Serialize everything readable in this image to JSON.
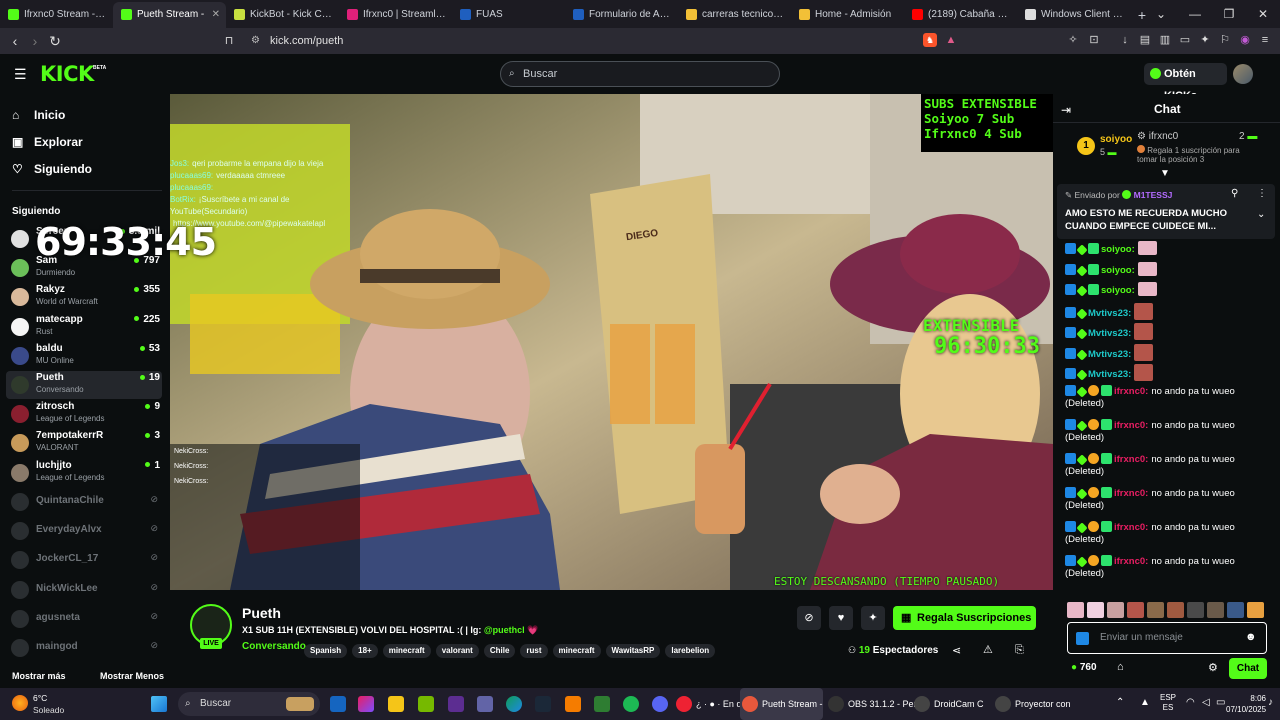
{
  "browser": {
    "tabs": [
      {
        "label": "Ifrxnc0 Stream - Kick D",
        "color": "#53fc18"
      },
      {
        "label": "Pueth Stream - ",
        "color": "#53fc18",
        "active": true
      },
      {
        "label": "KickBot - Kick Chatbot",
        "color": "#c8e040"
      },
      {
        "label": "Ifrxnc0 | Streamloots |",
        "color": "#e0207a"
      },
      {
        "label": "FUAS",
        "color": "#1f5fbf"
      },
      {
        "label": "Formulario de Acredita",
        "color": "#1f5fbf"
      },
      {
        "label": "carreras tecnico-en-ele",
        "color": "#f2c037"
      },
      {
        "label": "Home - Admisión",
        "color": "#f2c037"
      },
      {
        "label": "(2189) Cabaña acogedo",
        "color": "#ff0000"
      },
      {
        "label": "Windows Client | Droid",
        "color": "#ddd"
      }
    ],
    "new_tab": "+",
    "url": "kick.com/pueth"
  },
  "kick": {
    "logo": "KICK",
    "beta": "BETA",
    "search_placeholder": "Buscar",
    "get_kicks": "Obtén KICKs"
  },
  "sidebar": {
    "nav": [
      {
        "label": "Inicio",
        "icon": "⌂"
      },
      {
        "label": "Explorar",
        "icon": "▣"
      },
      {
        "label": "Siguiendo",
        "icon": "♡"
      }
    ],
    "following_title": "Siguiendo",
    "following": [
      {
        "name": "Spreen",
        "category": "",
        "count": "5.5 mil",
        "color": "#e0e0e0"
      },
      {
        "name": "Sam",
        "category": "Durmiendo",
        "count": "797",
        "color": "#6bbf59"
      },
      {
        "name": "Rakyz",
        "category": "World of Warcraft",
        "count": "355",
        "color": "#d9b99b"
      },
      {
        "name": "matecapp",
        "category": "Rust",
        "count": "225",
        "color": "#f5f5f5"
      },
      {
        "name": "baldu",
        "category": "MU Online",
        "count": "53",
        "color": "#3a4a8a"
      },
      {
        "name": "Pueth",
        "category": "Conversando",
        "count": "19",
        "color": "#2f3a2c"
      },
      {
        "name": "zitrosch",
        "category": "League of Legends",
        "count": "9",
        "color": "#8a1f2f"
      },
      {
        "name": "7empotakerrR",
        "category": "VALORANT",
        "count": "3",
        "color": "#c79a5a"
      },
      {
        "name": "luchjjto",
        "category": "League of Legends",
        "count": "1",
        "color": "#8a7a6a"
      }
    ],
    "offline": [
      "QuintanaChile",
      "EverydayAlvx",
      "JockerCL_17",
      "NickWickLee",
      "agusneta",
      "maingod"
    ],
    "show_more": "Mostrar más",
    "show_less": "Mostrar Menos"
  },
  "overlay": {
    "timer": "69:33:45",
    "subs_title": "SUBS EXTENSIBLE",
    "subs_lines": [
      "Soiyoo 7 Sub",
      "Ifrxnc0 4 Sub"
    ],
    "ext_label": "EXTENSIBLE",
    "ext_time": "96:30:33",
    "paused": "ESTOY DESCANSANDO (TIEMPO PAUSADO)",
    "menu_sign": "DIEGO",
    "cam_chat": [
      {
        "user": "Jos3:",
        "text": "qeri probarme la empana dijo la vieja"
      },
      {
        "user": "plucaaas69:",
        "text": "verdaaaaa ctmreee"
      },
      {
        "user": "plucaaas69:",
        "text": ""
      },
      {
        "user": "BotRix:",
        "text": "¡Suscríbete a mi canal de YouTube(Secundario)"
      },
      {
        "user": "",
        "text": "https://www.youtube.com/@pipewakatelapl"
      }
    ],
    "cam_list": [
      "NekiCross:",
      "NekiCross:",
      "NekiCross:"
    ]
  },
  "stream": {
    "name": "Pueth",
    "live": "LIVE",
    "title_prefix": "X1 SUB 11H (EXTENSIBLE) VOLVI DEL HOSPITAL :( | Ig:",
    "instagram": "@puethcl",
    "category": "Conversando",
    "tags": [
      "Spanish",
      "18+",
      "minecraft",
      "valorant",
      "Chile",
      "rust",
      "minecraft",
      "WawitasRP",
      "larebelion"
    ],
    "subscribe_label": "Regala Suscripciones",
    "viewers": "19",
    "viewers_label": "Espectadores"
  },
  "chat": {
    "title": "Chat",
    "leaderboard": {
      "rank1_user": "soiyoo",
      "rank1_count": "5",
      "rank2_user": "ifrxnc0",
      "rank2_count": "2",
      "gift_text": "Regala 1 suscripción para tomar la posición 3"
    },
    "pinned": {
      "sent_by_label": "Enviado por",
      "user": "M1TESSJ",
      "text": "AMO ESTO ME RECUERDA MUCHO CUANDO EMPECE CUIDECE MI..."
    },
    "messages": [
      {
        "user": "soiyoo:",
        "user_color": "#53fc18",
        "text": "",
        "kind": "emote"
      },
      {
        "user": "soiyoo:",
        "user_color": "#53fc18",
        "text": "",
        "kind": "emote"
      },
      {
        "user": "soiyoo:",
        "user_color": "#53fc18",
        "text": "",
        "kind": "emote"
      },
      {
        "user": "Mvtivs23:",
        "user_color": "#1ec8c8",
        "text": "",
        "kind": "emote2"
      },
      {
        "user": "Mvtivs23:",
        "user_color": "#1ec8c8",
        "text": "",
        "kind": "emote2"
      },
      {
        "user": "Mvtivs23:",
        "user_color": "#1ec8c8",
        "text": "",
        "kind": "emote2"
      },
      {
        "user": "Mvtivs23:",
        "user_color": "#1ec8c8",
        "text": "",
        "kind": "emote2"
      },
      {
        "user": "ifrxnc0:",
        "user_color": "#e91e63",
        "text": "no ando pa tu wueo",
        "deleted": "(Deleted)"
      },
      {
        "user": "ifrxnc0:",
        "user_color": "#e91e63",
        "text": "no ando pa tu wueo",
        "deleted": "(Deleted)"
      },
      {
        "user": "ifrxnc0:",
        "user_color": "#e91e63",
        "text": "no ando pa tu wueo",
        "deleted": "(Deleted)"
      },
      {
        "user": "ifrxnc0:",
        "user_color": "#e91e63",
        "text": "no ando pa tu wueo",
        "deleted": "(Deleted)"
      },
      {
        "user": "ifrxnc0:",
        "user_color": "#e91e63",
        "text": "no ando pa tu wueo",
        "deleted": "(Deleted)"
      },
      {
        "user": "ifrxnc0:",
        "user_color": "#e91e63",
        "text": "no ando pa tu wueo",
        "deleted": "(Deleted)"
      }
    ],
    "input_placeholder": "Enviar un mensaje",
    "kicks_balance": "760",
    "send_label": "Chat"
  },
  "taskbar": {
    "weather_temp": "6°C",
    "weather_desc": "Soleado",
    "search": "Buscar",
    "apps": [
      {
        "label": "¿ · ● · En dire",
        "color": "#e23"
      },
      {
        "label": "Pueth Stream -",
        "color": "#e8583c"
      },
      {
        "label": "OBS 31.1.2 - Per",
        "color": "#333"
      },
      {
        "label": "DroidCam C",
        "color": "#444"
      },
      {
        "label": "Proyector con",
        "color": "#444"
      }
    ],
    "lang_top": "ESP",
    "lang_bottom": "ES",
    "time": "8:06",
    "date": "07/10/2025"
  }
}
